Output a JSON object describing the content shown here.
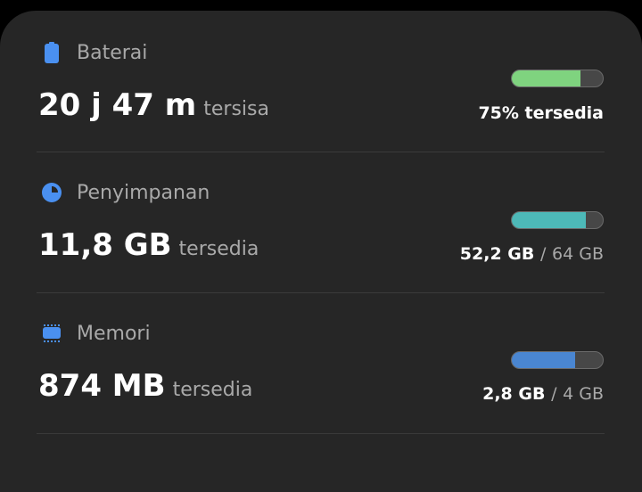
{
  "battery": {
    "title": "Baterai",
    "value": "20 j 47 m",
    "suffix": "tersisa",
    "status": "75% tersedia",
    "fraction": 0.75,
    "color": "#7fd37f"
  },
  "storage": {
    "title": "Penyimpanan",
    "value": "11,8 GB",
    "suffix": "tersedia",
    "used": "52,2 GB",
    "separator": "/",
    "total": "64 GB",
    "fraction": 0.816,
    "color": "#4db9b8"
  },
  "memory": {
    "title": "Memori",
    "value": "874 MB",
    "suffix": "tersedia",
    "used": "2,8 GB",
    "separator": "/",
    "total": "4 GB",
    "fraction": 0.7,
    "color": "#4a86d1"
  },
  "colors": {
    "background": "#000000",
    "card": "#262626",
    "icon_accent": "#4a90f0"
  }
}
